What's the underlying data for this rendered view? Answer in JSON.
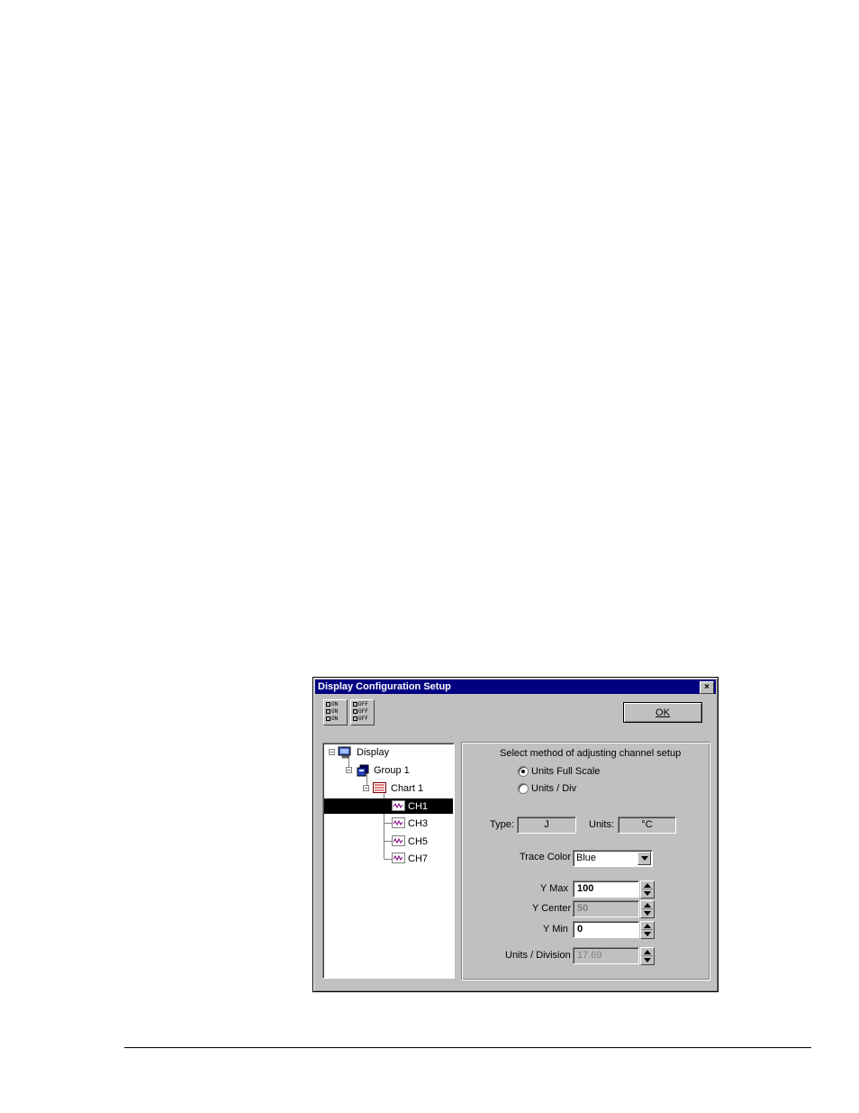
{
  "dialog": {
    "title": "Display Configuration  Setup",
    "close_label": "×",
    "ok_label": "OK"
  },
  "toolbar": {
    "all_on_labels": [
      "ON",
      "ON",
      "ON"
    ],
    "all_off_labels": [
      "OFF",
      "OFF",
      "OFF"
    ]
  },
  "tree": {
    "display": "Display",
    "group": "Group 1",
    "chart": "Chart 1",
    "channels": [
      "CH1",
      "CH3",
      "CH5",
      "CH7"
    ],
    "selected": "CH1"
  },
  "panel": {
    "method_prompt": "Select method of adjusting channel setup",
    "method_options": [
      "Units Full Scale",
      "Units / Div"
    ],
    "method_selected": "Units Full Scale",
    "type_label": "Type:",
    "type_value": "J",
    "units_label": "Units:",
    "units_value": "°C",
    "trace_color_label": "Trace Color",
    "trace_color_value": "Blue",
    "ymax_label": "Y Max",
    "ymax_value": "100",
    "ycenter_label": "Y Center",
    "ycenter_value": "50",
    "ymin_label": "Y Min",
    "ymin_value": "0",
    "units_div_label": "Units / Division",
    "units_div_value": "17.69"
  },
  "colors": {
    "titlebar": "#000080",
    "face": "#c0c0c0",
    "selection": "#000000"
  }
}
